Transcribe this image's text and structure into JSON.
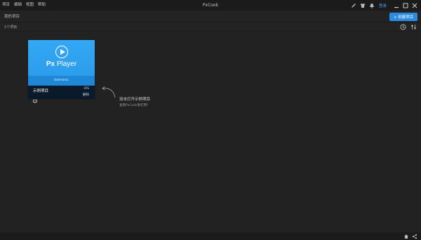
{
  "app": {
    "title": "PxCook"
  },
  "menu": [
    {
      "label": "项目"
    },
    {
      "label": "编辑"
    },
    {
      "label": "视图"
    },
    {
      "label": "帮助"
    }
  ],
  "titlebar": {
    "login_label": "登录"
  },
  "header": {
    "title": "我的项目",
    "new_button_label": "+ 创建项目"
  },
  "toolbar": {
    "count_label": "1个项目"
  },
  "project": {
    "name": "示例项目",
    "platform": "iOS",
    "delete_label": "删除",
    "logo_prefix": "Px",
    "logo_suffix": "Player",
    "author": "Ueimonic"
  },
  "hint": {
    "title": "双击打开示例项目",
    "subtitle": "查看PxCook来打用!"
  },
  "colors": {
    "accent": "#2a8be0",
    "background": "#222222",
    "thumb": "#2c9ff0"
  },
  "icons": [
    "pen-icon",
    "shirt-icon",
    "bell-icon",
    "minimize-icon",
    "maximize-icon",
    "close-icon",
    "history-icon",
    "filter-icon",
    "monitor-icon",
    "home-icon",
    "share-icon"
  ]
}
